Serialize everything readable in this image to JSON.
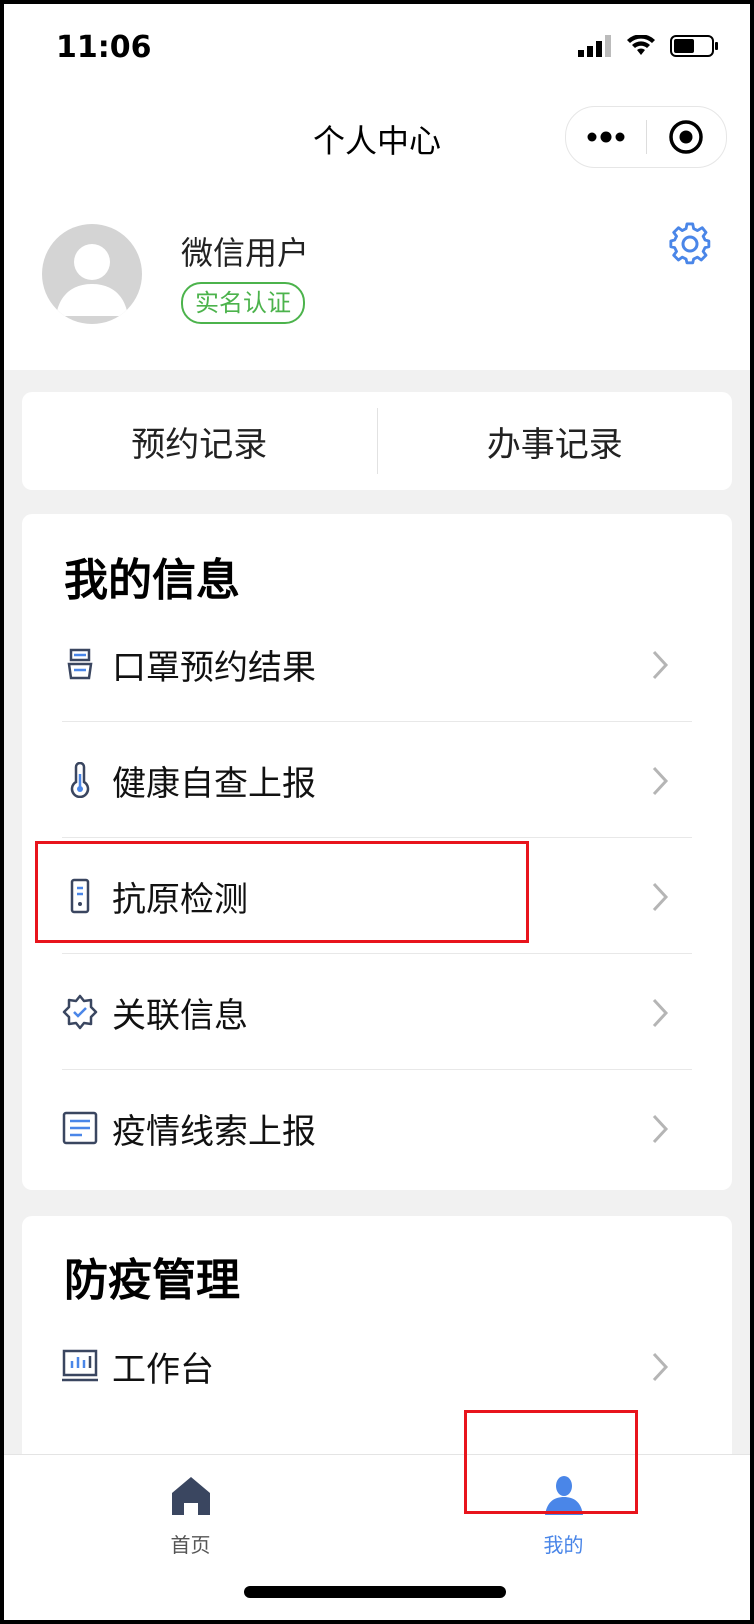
{
  "status": {
    "time": "11:06"
  },
  "nav": {
    "title": "个人中心"
  },
  "profile": {
    "username": "微信用户",
    "verify_badge": "实名认证"
  },
  "records": {
    "appointments": "预约记录",
    "affairs": "办事记录"
  },
  "my_info": {
    "title": "我的信息",
    "items": [
      {
        "label": "口罩预约结果",
        "icon": "mask-icon"
      },
      {
        "label": "健康自查上报",
        "icon": "thermometer-icon"
      },
      {
        "label": "抗原检测",
        "icon": "test-kit-icon"
      },
      {
        "label": "关联信息",
        "icon": "badge-check-icon"
      },
      {
        "label": "疫情线索上报",
        "icon": "document-icon"
      }
    ]
  },
  "epidemic_mgmt": {
    "title": "防疫管理",
    "items": [
      {
        "label": "工作台",
        "icon": "dashboard-icon"
      }
    ]
  },
  "tabs": [
    {
      "label": "首页",
      "icon": "home-icon",
      "active": false
    },
    {
      "label": "我的",
      "icon": "user-icon",
      "active": true
    }
  ],
  "colors": {
    "accent": "#4a86e8",
    "verify_green": "#4cb34c",
    "highlight_red": "#e8141c",
    "icon_navy": "#3a4660"
  }
}
